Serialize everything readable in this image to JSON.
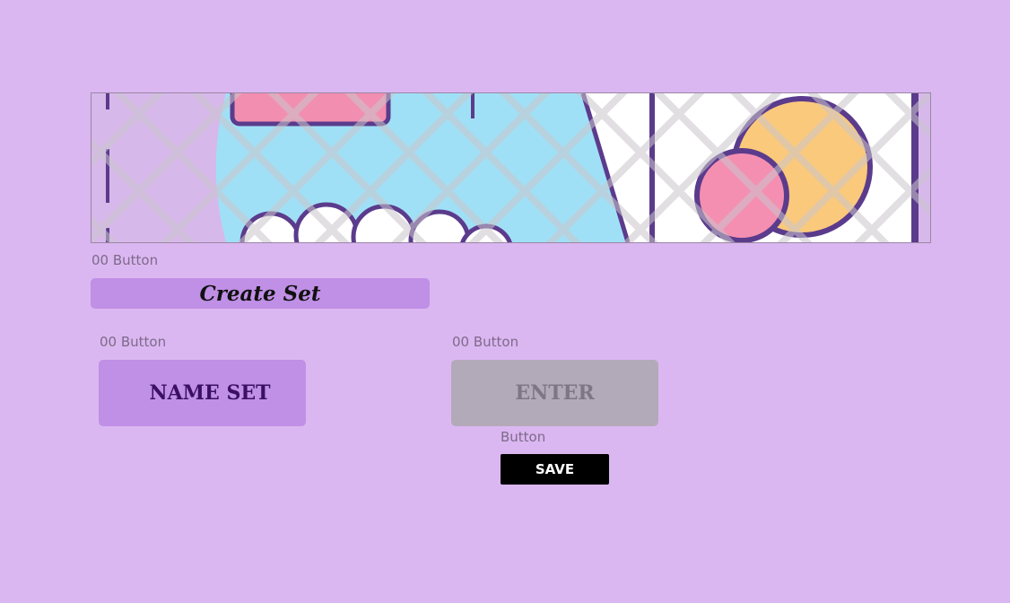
{
  "banner": {
    "name": "decorative-banner-image"
  },
  "buttons": {
    "create_set": {
      "caption": "00 Button",
      "label": "Create Set"
    },
    "name_set": {
      "caption": "00 Button",
      "label": "NAME SET"
    },
    "enter": {
      "caption": "00 Button",
      "label": "ENTER"
    },
    "save": {
      "caption": "Button",
      "label": "SAVE"
    }
  },
  "colors": {
    "background": "#dbb7f1",
    "primary_button": "#c08fe6",
    "disabled_button": "#b3aab9",
    "save_button": "#000000",
    "name_set_text": "#3b0f63"
  }
}
